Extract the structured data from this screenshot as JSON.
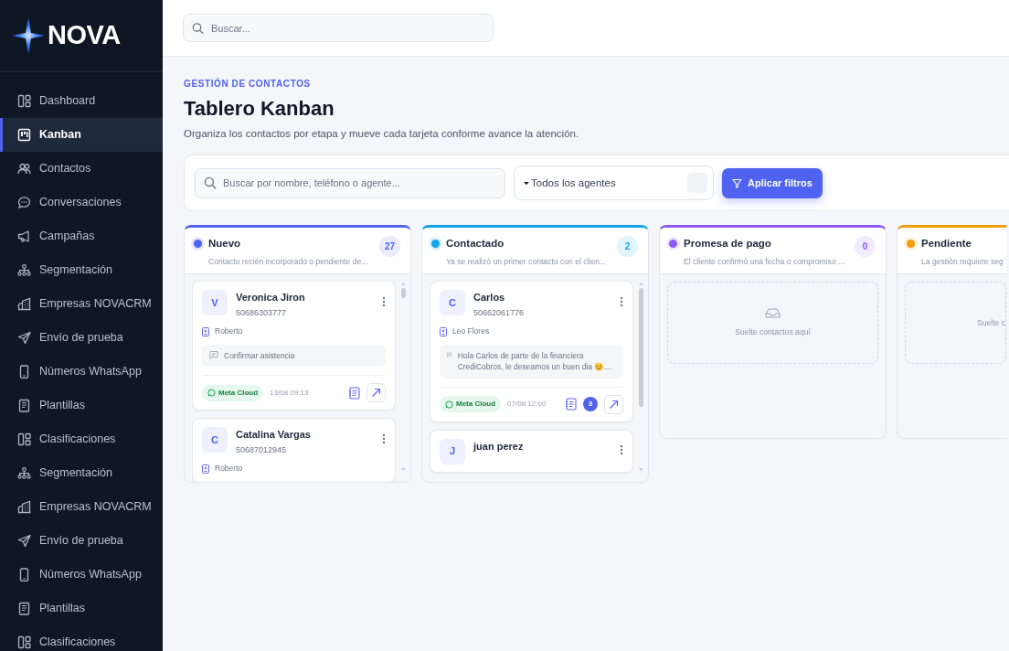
{
  "brand": "NOVA",
  "sidebar": {
    "items": [
      {
        "label": "Dashboard",
        "kind": "dashboard",
        "selected": false
      },
      {
        "label": "Kanban",
        "kind": "kanban",
        "selected": true
      },
      {
        "label": "Contactos",
        "kind": "contacts",
        "selected": false
      },
      {
        "label": "Conversaciones",
        "kind": "chat",
        "selected": false
      },
      {
        "label": "Campañas",
        "kind": "megaphone",
        "selected": false
      },
      {
        "label": "Segmentación",
        "kind": "tree",
        "selected": false
      },
      {
        "label": "Empresas NOVACRM",
        "kind": "building",
        "selected": false
      },
      {
        "label": "Envío de prueba",
        "kind": "send",
        "selected": false
      },
      {
        "label": "Números WhatsApp",
        "kind": "phone",
        "selected": false
      },
      {
        "label": "Plantillas",
        "kind": "doc",
        "selected": false
      },
      {
        "label": "Clasificaciones",
        "kind": "dashboard",
        "selected": false
      },
      {
        "label": "Segmentación",
        "kind": "tree",
        "selected": false
      },
      {
        "label": "Empresas NOVACRM",
        "kind": "building",
        "selected": false
      },
      {
        "label": "Envío de prueba",
        "kind": "send",
        "selected": false
      },
      {
        "label": "Números WhatsApp",
        "kind": "phone",
        "selected": false
      },
      {
        "label": "Plantillas",
        "kind": "doc",
        "selected": false
      },
      {
        "label": "Clasificaciones",
        "kind": "dashboard",
        "selected": false
      }
    ]
  },
  "topbar": {
    "search": {
      "placeholder": "Buscar..."
    }
  },
  "header": {
    "eyebrow": "GESTIÓN DE CONTACTOS",
    "title": "Tablero Kanban",
    "subtitle": "Organiza los contactos por etapa y mueve cada tarjeta conforme avance la atención."
  },
  "filters": {
    "search": {
      "placeholder": "Buscar por nombre, teléfono o agente..."
    },
    "agent_select": {
      "value": "Todos los agentes"
    },
    "apply_button": "Aplicar filtros"
  },
  "columns": [
    {
      "title": "Nuevo",
      "description": "Contacto recién incorporado o pendiente de...",
      "count": "27",
      "color": "#4f63f0",
      "cards": [
        {
          "initial": "V",
          "name": "Veronica Jiron",
          "phone": "50686303777",
          "agent": "Roberto",
          "note": "Confirmar asistencia",
          "channel": "Meta Cloud",
          "date": "13/08 09:13"
        },
        {
          "initial": "C",
          "name": "Catalina Vargas",
          "phone": "50687012945",
          "agent": "Roberto"
        }
      ]
    },
    {
      "title": "Contactado",
      "description": "Ya se realizó un primer contacto con el clien...",
      "count": "2",
      "color": "#0ea5e9",
      "cards": [
        {
          "initial": "C",
          "name": "Carlos",
          "phone": "50662061776",
          "agent": "Leo Flores",
          "note": "Hola Carlos de parte de la financiera CrediCobros, le deseamos un buen dia 😊...",
          "channel": "Meta Cloud",
          "date": "07/08 12:00",
          "comments": "3"
        },
        {
          "initial": "J",
          "name": "juan perez"
        }
      ]
    },
    {
      "title": "Promesa de pago",
      "description": "El cliente confirmó una fecha o compromiso ...",
      "count": "0",
      "color": "#8b5cf6",
      "empty_text": "Suelte contactos aquí"
    },
    {
      "title": "Pendiente",
      "description": "La gestión requiere seg",
      "color": "#f59e0b",
      "empty_text": "Suelte c"
    }
  ]
}
